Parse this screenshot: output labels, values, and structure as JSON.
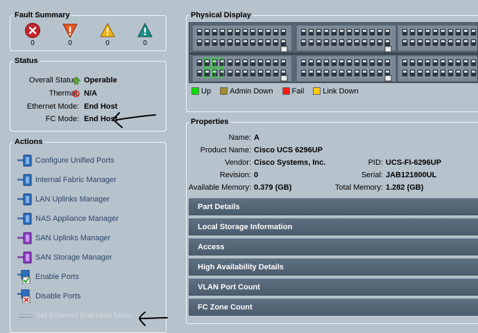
{
  "fault_summary": {
    "title": "Fault Summary",
    "items": [
      {
        "icon": "critical-icon",
        "count": "0",
        "color": "#c0262c"
      },
      {
        "icon": "major-icon",
        "count": "0",
        "color": "#e8561e"
      },
      {
        "icon": "minor-icon",
        "count": "0",
        "color": "#f2b116"
      },
      {
        "icon": "warning-icon",
        "count": "0",
        "color": "#1d8f87"
      }
    ]
  },
  "status": {
    "title": "Status",
    "rows": [
      {
        "label": "Overall Status:",
        "value": "Operable",
        "icon": "up-arrow-icon"
      },
      {
        "label": "Thermal:",
        "value": "N/A",
        "icon": "no-entry-icon"
      },
      {
        "label": "Ethernet Mode:",
        "value": "End Host"
      },
      {
        "label": "FC Mode:",
        "value": "End Host"
      }
    ]
  },
  "actions": {
    "title": "Actions",
    "items": [
      {
        "label": "Configure Unified Ports",
        "icon": "port-icon"
      },
      {
        "label": "Internal Fabric Manager",
        "icon": "port-icon"
      },
      {
        "label": "LAN Uplinks Manager",
        "icon": "port-icon"
      },
      {
        "label": "NAS Appliance Manager",
        "icon": "port-icon"
      },
      {
        "label": "SAN Uplinks Manager",
        "icon": "san-port-icon"
      },
      {
        "label": "SAN Storage Manager",
        "icon": "san-port-icon"
      },
      {
        "label": "Enable Ports",
        "icon": "enable-port-icon"
      },
      {
        "label": "Disable Ports",
        "icon": "disable-port-icon"
      },
      {
        "label": "Set Ethernet End-Host Mode",
        "icon": "ethernet-mode-icon",
        "disabled": true
      }
    ]
  },
  "physical_display": {
    "title": "Physical Display",
    "legend": [
      {
        "label": "Up",
        "color": "#00e000"
      },
      {
        "label": "Admin Down",
        "color": "#a08a2a"
      },
      {
        "label": "Fail",
        "color": "#ff1a1a"
      },
      {
        "label": "Link Down",
        "color": "#ffc800"
      }
    ]
  },
  "properties": {
    "title": "Properties",
    "name_label": "Name:",
    "name": "A",
    "product_label": "Product Name:",
    "product": "Cisco UCS 6296UP",
    "vendor_label": "Vendor:",
    "vendor": "Cisco Systems, Inc.",
    "pid_label": "PID:",
    "pid": "UCS-FI-6296UP",
    "revision_label": "Revision:",
    "revision": "0",
    "serial_label": "Serial:",
    "serial": "JAB121800UL",
    "avail_mem_label": "Available Memory:",
    "avail_mem": "0.379 (GB)",
    "total_mem_label": "Total Memory:",
    "total_mem": "1.282 (GB)",
    "sections": [
      "Part Details",
      "Local Storage Information",
      "Access",
      "High Availability Details",
      "VLAN Port Count",
      "FC Zone Count"
    ]
  },
  "colors": {
    "background": "#b6c2cc",
    "section_header": "#566878",
    "action_link": "#2d4566"
  }
}
